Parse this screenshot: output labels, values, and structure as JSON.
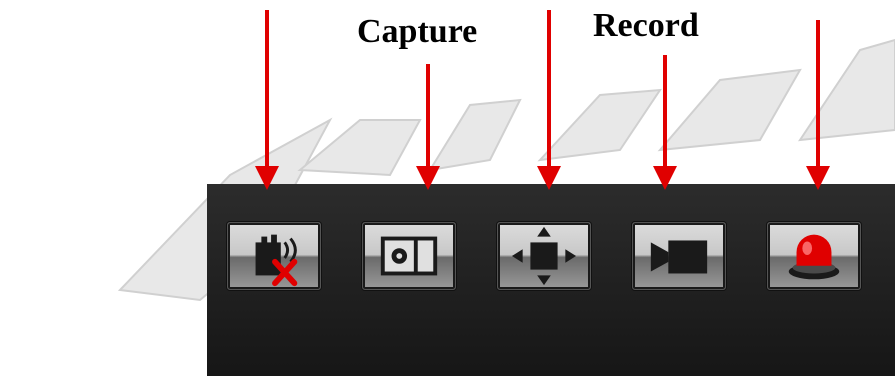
{
  "labels": {
    "capture": "Capture",
    "record": "Record"
  },
  "toolbar": {
    "buttons": [
      {
        "icon": "audio-mute-icon"
      },
      {
        "icon": "capture-icon"
      },
      {
        "icon": "ptz-control-icon"
      },
      {
        "icon": "record-icon"
      },
      {
        "icon": "alarm-icon"
      }
    ]
  },
  "colors": {
    "arrow": "#e00000",
    "toolbar": "#1f1f1f",
    "alarm": "#e00000"
  }
}
